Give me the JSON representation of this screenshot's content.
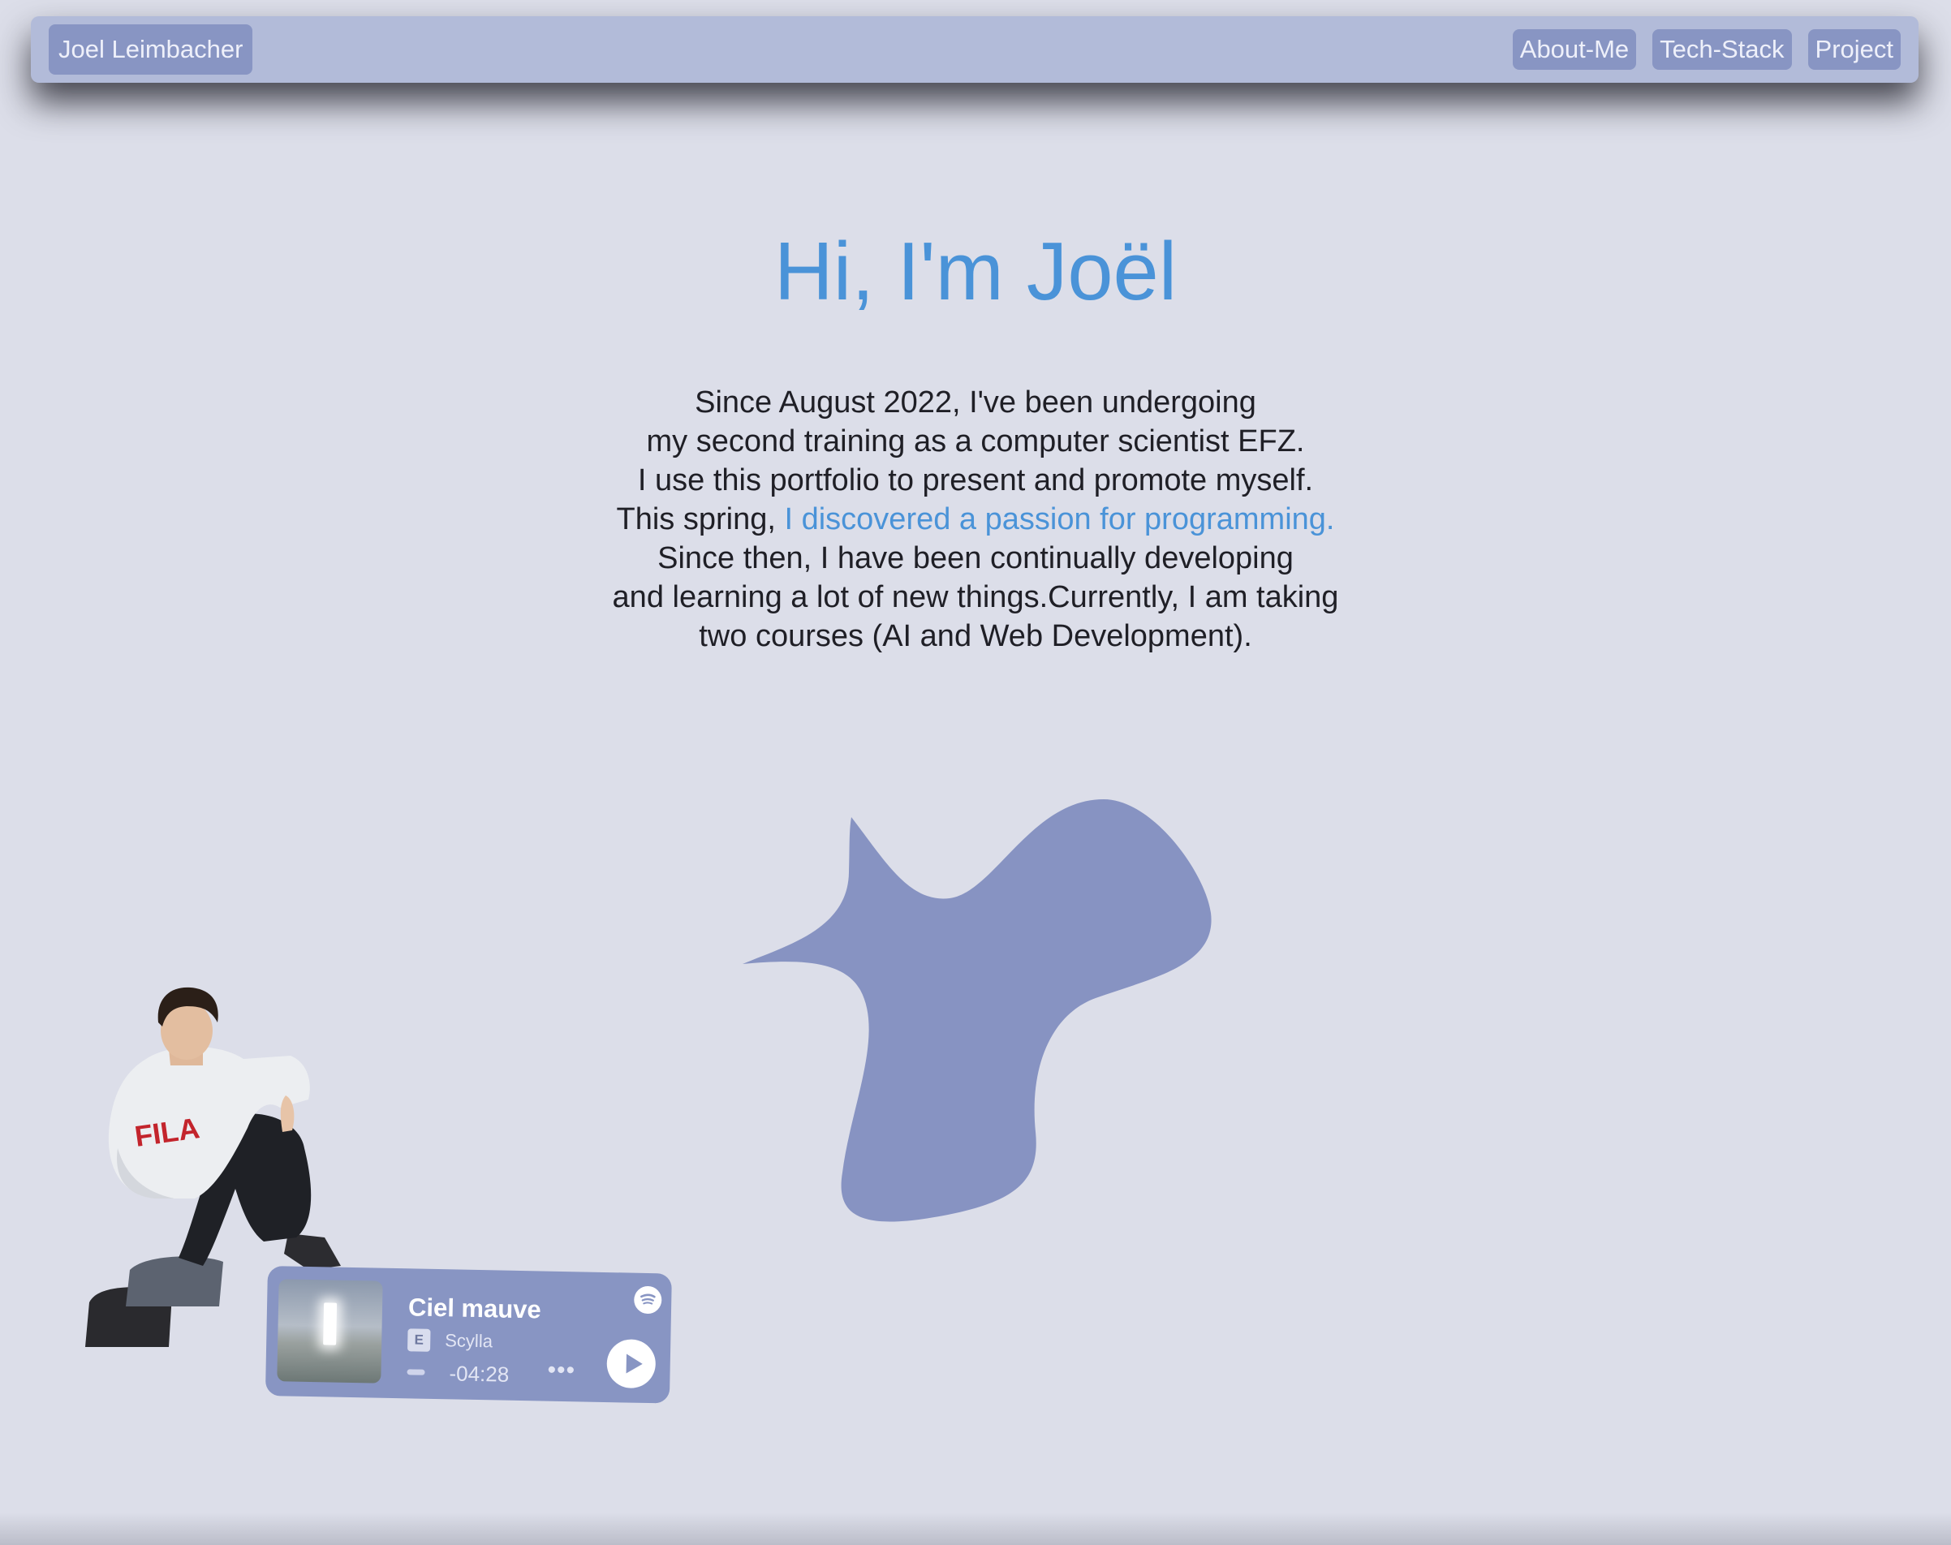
{
  "navbar": {
    "brand": "Joel Leimbacher",
    "links": [
      {
        "label": "About-Me"
      },
      {
        "label": "Tech-Stack"
      },
      {
        "label": "Project"
      }
    ]
  },
  "hero": {
    "title": "Hi, I'm Joël",
    "bio": {
      "line1": "Since August 2022, I've been undergoing",
      "line2": "my second training as a computer scientist EFZ.",
      "line3": "I use this portfolio to present and promote myself.",
      "line4_prefix": "This spring, ",
      "line4_highlight": "I discovered a passion for programming.",
      "line5": "Since then, I have been continually developing",
      "line6": "and learning a lot of new things.Currently, I am taking",
      "line7": "two courses (AI and Web Development)."
    }
  },
  "spotify_card": {
    "track_title": "Ciel mauve",
    "explicit_label": "E",
    "artist": "Scylla",
    "time_remaining": "-04:28",
    "more_label": "•••",
    "icons": {
      "play": "play-icon",
      "logo": "spotify-icon",
      "more": "more-icon"
    }
  },
  "colors": {
    "background": "#dcdee9",
    "navbar": "#b2bbd9",
    "nav_button": "#8895c3",
    "accent": "#4a93d8",
    "blob": "#8793c2",
    "card": "#8895c3"
  }
}
